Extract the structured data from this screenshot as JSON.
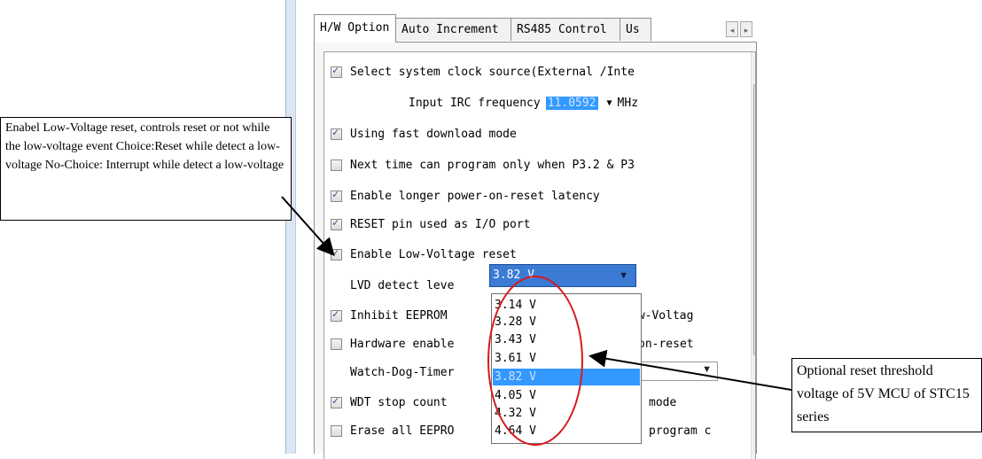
{
  "tabs": [
    {
      "label": "H/W Option"
    },
    {
      "label": "Auto Increment"
    },
    {
      "label": "RS485 Control"
    },
    {
      "label": "Us"
    }
  ],
  "options": [
    {
      "label": "Select system clock source(External /Inte",
      "checked": true
    },
    {
      "label_prefix": "Input IRC frequency",
      "value": "11.0592",
      "unit": "MHz"
    },
    {
      "label": "Using fast download mode",
      "checked": true
    },
    {
      "label": "Next time can program only when P3.2 & P3",
      "checked": false
    },
    {
      "label": "Enable longer power-on-reset latency",
      "checked": true
    },
    {
      "label": "RESET pin used as I/O port",
      "checked": true
    },
    {
      "label": "Enable Low-Voltage reset",
      "checked": true
    },
    {
      "label_prefix": "LVD detect leve",
      "value": "3.82 V"
    },
    {
      "label": "Inhibit EEPROM",
      "label_suffix": "ow-Voltag",
      "checked": true
    },
    {
      "label": "Hardware enable",
      "label_suffix": "on-reset",
      "checked": false
    },
    {
      "label": "Watch-Dog-Timer"
    },
    {
      "label": "WDT stop count",
      "label_suffix": "mode",
      "checked": true
    },
    {
      "label": "Erase all EEPRO",
      "label_suffix": "program c",
      "checked": false
    }
  ],
  "lvd_dropdown": {
    "items": [
      "3.14 V",
      "3.28 V",
      "3.43 V",
      "3.61 V",
      "3.82 V",
      "4.05 V",
      "4.32 V",
      "4.64 V"
    ],
    "selected": "3.82 V"
  },
  "annotations": {
    "left": "Enabel Low-Voltage reset, controls reset or not while the low-voltage event Choice:Reset while detect a low-voltage No-Choice: Interrupt while detect a low-voltage",
    "right": "Optional reset threshold voltage of 5V MCU of STC15 series"
  },
  "colors": {
    "highlight": "#3399ff",
    "ellipse": "#d7191c",
    "check": "#2b4e86"
  }
}
